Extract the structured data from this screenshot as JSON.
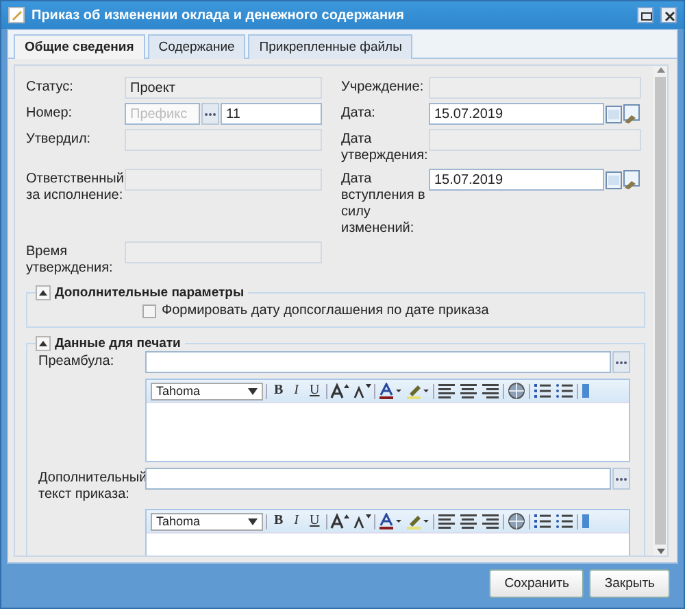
{
  "window": {
    "title": "Приказ об изменении оклада и денежного содержания"
  },
  "tabs": [
    {
      "label": "Общие сведения",
      "selected": true
    },
    {
      "label": "Содержание",
      "selected": false
    },
    {
      "label": "Прикрепленные файлы",
      "selected": false
    }
  ],
  "form_rows": [
    {
      "left": {
        "label": "Статус:",
        "kind": "readonly",
        "value": "Проект"
      },
      "right": {
        "label": "Учреждение:",
        "kind": "readonly"
      }
    },
    {
      "left": {
        "label": "Номер:",
        "kind": "number",
        "placeholder": "Префикс",
        "value": "11"
      },
      "right": {
        "label": "Дата:",
        "kind": "date",
        "value": "15.07.2019"
      }
    },
    {
      "left": {
        "label": "Утвердил:",
        "kind": "readonly"
      },
      "right": {
        "label": "Дата утверждения:",
        "kind": "readonly"
      }
    },
    {
      "left": {
        "label": "Ответственный за исполнение:",
        "kind": "readonly"
      },
      "right": {
        "label": "Дата вступления в силу изменений:",
        "kind": "date",
        "value": "15.07.2019"
      }
    },
    {
      "left": {
        "label": "Время утверждения:",
        "kind": "readonly"
      }
    }
  ],
  "extra_params": {
    "title": "Дополнительные параметры",
    "expanded": true,
    "checkbox": {
      "label": "Формировать дату допсоглашения по дате приказа",
      "checked": false
    }
  },
  "print_data": {
    "title": "Данные для печати",
    "expanded": true,
    "fields": [
      {
        "label": "Преамбула:",
        "font": "Tahoma",
        "format_buttons": [
          "B",
          "I",
          "U"
        ]
      },
      {
        "label": "Дополнительный текст приказа:",
        "font": "Tahoma",
        "format_buttons": [
          "B",
          "I",
          "U"
        ]
      }
    ]
  },
  "buttons": [
    "Сохранить",
    "Закрыть"
  ]
}
